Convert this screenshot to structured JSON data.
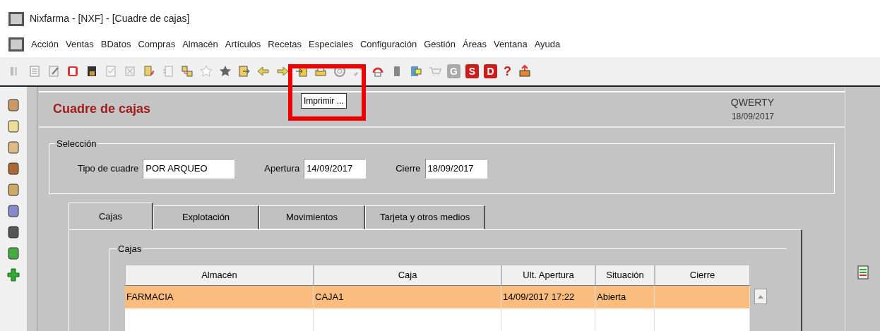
{
  "window": {
    "title": "Nixfarma - [NXF] - [Cuadre de cajas]"
  },
  "menu": [
    "Acción",
    "Ventas",
    "BDatos",
    "Compras",
    "Almacén",
    "Artículos",
    "Recetas",
    "Especiales",
    "Configuración",
    "Gestión",
    "Áreas",
    "Ventana",
    "Ayuda"
  ],
  "toolbar_letters": [
    {
      "label": "G",
      "disabled": true
    },
    {
      "label": "S",
      "disabled": false
    },
    {
      "label": "D",
      "disabled": false
    }
  ],
  "toolbar_help": "?",
  "tooltip": "Imprimir ...",
  "header": {
    "title": "Cuadre de cajas",
    "user": "QWERTY",
    "date": "18/09/2017"
  },
  "selection": {
    "legend": "Selección",
    "fields": [
      {
        "label": "Tipo de cuadre",
        "value": "POR ARQUEO"
      },
      {
        "label": "Apertura",
        "value": "14/09/2017"
      },
      {
        "label": "Cierre",
        "value": "18/09/2017"
      }
    ]
  },
  "tabs": [
    {
      "label": "Cajas",
      "selected": true
    },
    {
      "label": "Explotación",
      "selected": false
    },
    {
      "label": "Movimientos",
      "selected": false
    },
    {
      "label": "Tarjeta y otros medios",
      "selected": false
    }
  ],
  "table": {
    "legend": "Cajas",
    "columns": [
      "Almacén",
      "Caja",
      "Ult. Apertura",
      "Situación",
      "Cierre"
    ],
    "rows": [
      {
        "cells": [
          "FARMACIA",
          "CAJA1",
          "14/09/2017 17:22",
          "Abierta",
          ""
        ],
        "selected": true
      },
      {
        "cells": [
          "",
          "",
          "",
          "",
          ""
        ],
        "selected": false
      }
    ]
  }
}
